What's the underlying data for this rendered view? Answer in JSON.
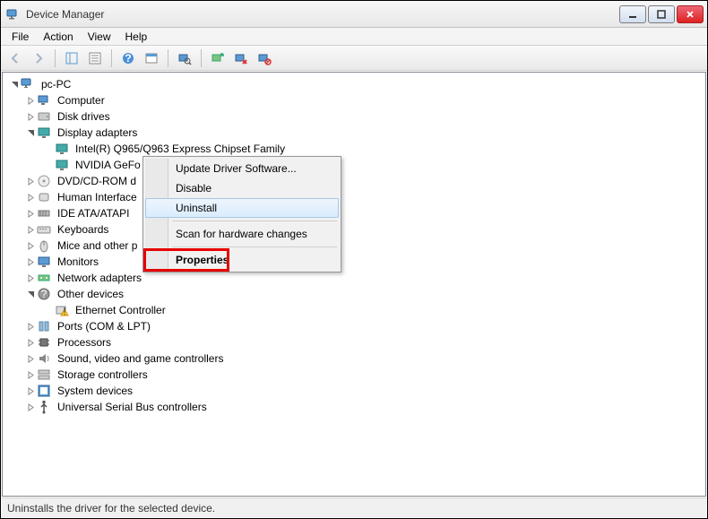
{
  "window": {
    "title": "Device Manager"
  },
  "menubar": {
    "items": [
      "File",
      "Action",
      "View",
      "Help"
    ]
  },
  "tree": {
    "root": "pc-PC",
    "nodes": [
      {
        "label": "Computer",
        "icon": "computer"
      },
      {
        "label": "Disk drives",
        "icon": "disk"
      },
      {
        "label": "Display adapters",
        "icon": "display",
        "expanded": true,
        "children": [
          {
            "label": "Intel(R)  Q965/Q963 Express Chipset Family",
            "icon": "display"
          },
          {
            "label": "NVIDIA GeFo",
            "icon": "display",
            "truncated": true
          }
        ]
      },
      {
        "label": "DVD/CD-ROM d",
        "icon": "optical",
        "truncated": true
      },
      {
        "label": "Human Interface",
        "icon": "hid",
        "truncated": true
      },
      {
        "label": "IDE ATA/ATAPI",
        "icon": "ide",
        "truncated": true
      },
      {
        "label": "Keyboards",
        "icon": "keyboard"
      },
      {
        "label": "Mice and other p",
        "icon": "mouse",
        "truncated": true
      },
      {
        "label": "Monitors",
        "icon": "monitor"
      },
      {
        "label": "Network adapters",
        "icon": "network",
        "truncated": true
      },
      {
        "label": "Other devices",
        "icon": "other",
        "expanded": true,
        "children": [
          {
            "label": "Ethernet Controller",
            "icon": "warning"
          }
        ]
      },
      {
        "label": "Ports (COM & LPT)",
        "icon": "ports"
      },
      {
        "label": "Processors",
        "icon": "cpu"
      },
      {
        "label": "Sound, video and game controllers",
        "icon": "sound"
      },
      {
        "label": "Storage controllers",
        "icon": "storage"
      },
      {
        "label": "System devices",
        "icon": "system"
      },
      {
        "label": "Universal Serial Bus controllers",
        "icon": "usb"
      }
    ]
  },
  "context_menu": {
    "items": [
      {
        "label": "Update Driver Software..."
      },
      {
        "label": "Disable"
      },
      {
        "label": "Uninstall",
        "hover": true
      },
      {
        "sep": true
      },
      {
        "label": "Scan for hardware changes"
      },
      {
        "sep": true
      },
      {
        "label": "Properties",
        "highlight": true,
        "bold": true
      }
    ]
  },
  "statusbar": {
    "text": "Uninstalls the driver for the selected device."
  }
}
